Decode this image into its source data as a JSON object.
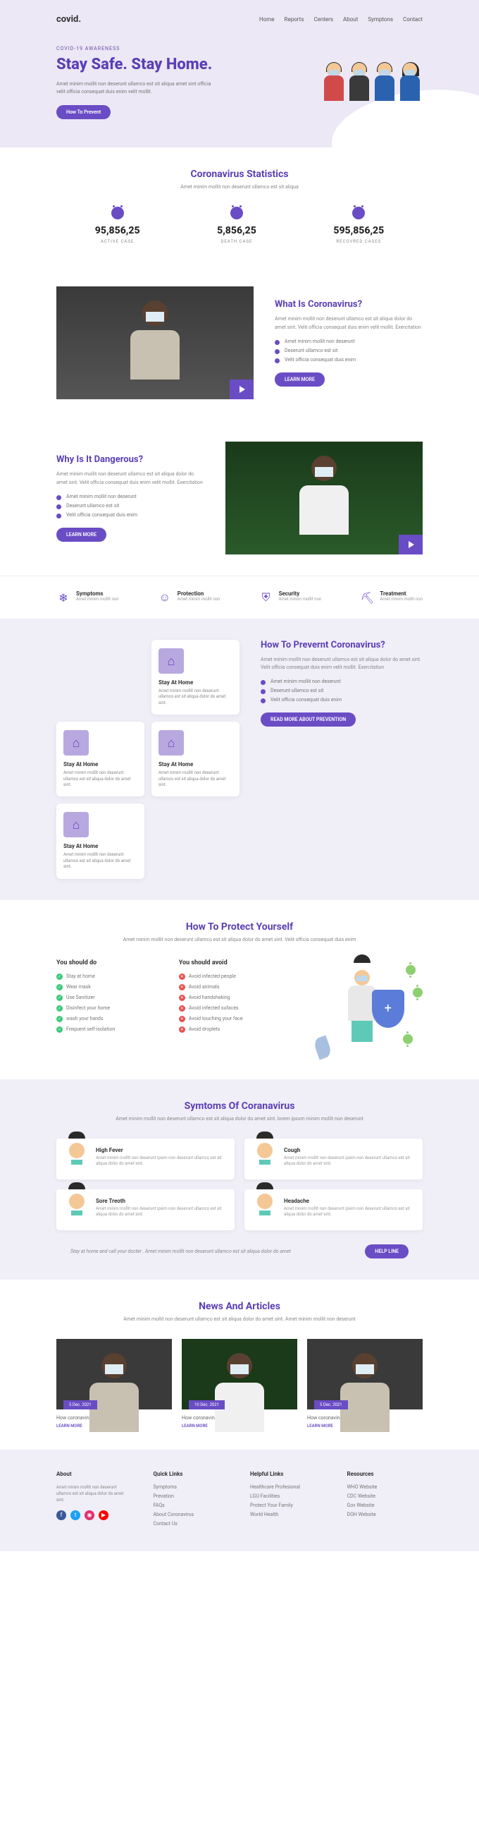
{
  "nav": {
    "logo": "covid.",
    "links": [
      "Home",
      "Reports",
      "Centers",
      "About",
      "Symptons",
      "Contact"
    ]
  },
  "hero": {
    "eyebrow": "COVID-19 AWARENESS",
    "title": "Stay Safe. Stay Home.",
    "subtitle": "Amet minim mollit non deserunt ullamco est sit aliqua amet sint officia velit officia consequat duis enim velit mollit.",
    "cta": "How To Prevent"
  },
  "stats": {
    "title": "Coronavirus  Statistics",
    "subtitle": "Amet minim mollit non deserunt ullamco est sit aliqua",
    "items": [
      {
        "value": "95,856,25",
        "label": "ACTIVE CASE"
      },
      {
        "value": "5,856,25",
        "label": "DEATH CASE"
      },
      {
        "value": "595,856,25",
        "label": "RECOVRED CASES"
      }
    ]
  },
  "what": {
    "title": "What Is Coronavirus?",
    "text": "Amet minim mollit non deserunt ullamco est sit aliqua dolor do amet sint. Velit officia consequat duis enim velit mollit. Exercitation",
    "bullets": [
      "Amet minim mollit non deserunt",
      "Deserunt ullamco est sit",
      "Velit officia consequat duis enim"
    ],
    "cta": "LEARN MORE"
  },
  "why": {
    "title": "Why Is It Dangerous?",
    "text": "Amet minim mollit non deserunt ullamco est sit aliqua dolor do amet sint. Velit officia consequat duis enim velit mollit. Exercitation",
    "bullets": [
      "Amet minim mollit non deserunt",
      "Deserunt ullamco est sit",
      "Velit officia consequat duis enim"
    ],
    "cta": "LEARN MORE"
  },
  "features": [
    {
      "icon": "❄",
      "title": "Symptoms",
      "sub": "Amet minim mollit non"
    },
    {
      "icon": "☺",
      "title": "Protection",
      "sub": "Amet minim mollit non"
    },
    {
      "icon": "⛨",
      "title": "Security",
      "sub": "Amet minim mollit non"
    },
    {
      "icon": "⛏",
      "title": "Treatment",
      "sub": "Amet minim mollit non"
    }
  ],
  "prevent": {
    "title": "How To Prevernt Coronavirus?",
    "text": "Amet minim mollit non deserunt ullamco est sit aliqua dolor do amet sint. Velit officia consequat duis enim velit mollit. Exercitation",
    "bullets": [
      "Amet minim mollit non deserunt",
      "Deserunt ullamco est sit",
      "Velit officia consequat duis enim"
    ],
    "cta": "READ MORE ABOUT PREVENTION",
    "cards": [
      {
        "title": "Stay At Home",
        "text": "Amet minim mollit non deserunt ullamco est sit aliqua dolor do amet sint."
      },
      {
        "title": "Stay At Home",
        "text": "Amet minim mollit non deserunt ullamco est sit aliqua dolor do amet sint."
      },
      {
        "title": "Stay At Home",
        "text": "Amet minim mollit non deserunt ullamco est sit aliqua dolor do amet sint."
      },
      {
        "title": "Stay At Home",
        "text": "Amet minim mollit non deserunt ullamco est sit aliqua dolor do amet sint."
      }
    ]
  },
  "protect": {
    "title": "How To Protect Yourself",
    "subtitle": "Amet minim mollit non deserunt ullamco est sit aliqua dolor do amet sint. Velit officia consequat duis enim",
    "do_title": "You should do",
    "avoid_title": "You should avoid",
    "do": [
      "Stay at home",
      "Wear mask",
      "Use Sanitizer",
      "Disinfect your home",
      "wash your hands",
      "Frequent self-isolation"
    ],
    "avoid": [
      "Avoid infected people",
      "Avoid animals",
      "Avoid  handshaking",
      "Avoid infected sufaces",
      "Avoid touching your face",
      "Avoid droplets"
    ]
  },
  "symptoms": {
    "title": "Symtoms Of Coranavirus",
    "subtitle": "Amet minim mollit non deserunt ullamco est sit aliqua dolor do amet sint. lorem ipsum minim mollit non deserunt",
    "items": [
      {
        "title": "High Fever",
        "text": "Amet minim mollit non deserunt ipsim non deserunt ullamco est sit aliqua dolor do amet sint."
      },
      {
        "title": "Cough",
        "text": "Amet minim mollit non deserunt ipsim non deserunt ullamco est sit aliqua dolor do amet sint."
      },
      {
        "title": "Sore Treoth",
        "text": "Amet minim mollit non deserunt ipsim non deserunt ullamco est sit aliqua dolor do amet sint."
      },
      {
        "title": "Headache",
        "text": "Amet minim mollit non deserunt ipsim non deserunt ullamco est sit aliqua dolor do amet sint."
      }
    ],
    "helpline_text": "Stay at home and call your docter . Amet minim mollit non deserunt ullamco est sit aliqua dolor do amet",
    "helpline_cta": "HELP LINE"
  },
  "news": {
    "title": "News And Articles",
    "subtitle": "Amet minim mollit non deserunt ullamco est sit aliqua dolor do amet sint. Amet minim mollit non deserunt",
    "items": [
      {
        "date": "5 Dec. 2021",
        "title": "How coronavirus very contigious",
        "link": "LEARN MORE"
      },
      {
        "date": "10 Dec. 2021",
        "title": "How coronavirus very contigious",
        "link": "LEARN MORE"
      },
      {
        "date": "5 Dec. 2021",
        "title": "How coronavirus very contigious",
        "link": "LEARN MORE"
      }
    ]
  },
  "footer": {
    "about_title": "About",
    "about_text": "Amet minim mollit non deserunt ullamco est sit aliqua dolor do amet sint.",
    "cols": [
      {
        "title": "Quick Links",
        "links": [
          "Symptoms",
          "Prevation",
          "FAQs",
          "About Coronavirus",
          "Contact Us"
        ]
      },
      {
        "title": "Helpful Links",
        "links": [
          "Healthcare Profesional",
          "LGU Facilities",
          "Protect Your Family",
          "World Health"
        ]
      },
      {
        "title": "Resources",
        "links": [
          "WHO Website",
          "CDC Website",
          "Gov Website",
          "DOH Website"
        ]
      }
    ]
  }
}
